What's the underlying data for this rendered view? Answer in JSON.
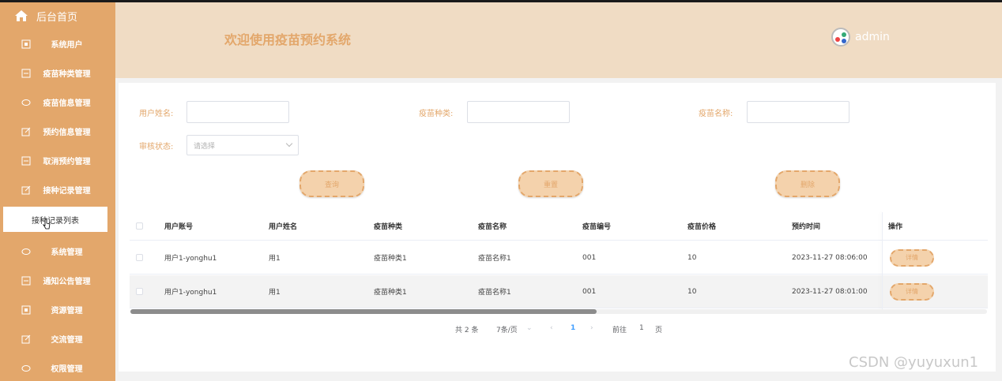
{
  "sidebar": {
    "home_label": "后台首页",
    "items": [
      {
        "label": "系统用户",
        "icon": "square-icon"
      },
      {
        "label": "疫苗种类管理",
        "icon": "square-icon"
      },
      {
        "label": "疫苗信息管理",
        "icon": "cloud-icon"
      },
      {
        "label": "预约信息管理",
        "icon": "edit-icon"
      },
      {
        "label": "取消预约管理",
        "icon": "square-icon"
      },
      {
        "label": "接种记录管理",
        "icon": "edit-icon"
      }
    ],
    "active_sub": "接种记录列表",
    "items_after": [
      {
        "label": "系统管理",
        "icon": "cloud-icon"
      },
      {
        "label": "通知公告管理",
        "icon": "square-icon"
      },
      {
        "label": "资源管理",
        "icon": "square-icon"
      },
      {
        "label": "交流管理",
        "icon": "edit-icon"
      },
      {
        "label": "权限管理",
        "icon": "cloud-icon"
      }
    ]
  },
  "header": {
    "title": "欢迎使用疫苗预约系统",
    "username": "admin"
  },
  "search": {
    "user_name_label": "用户姓名:",
    "vaccine_type_label": "疫苗种类:",
    "vaccine_name_label": "疫苗名称:",
    "review_status_label": "审核状态:",
    "review_status_placeholder": "请选择",
    "query_button": "查询",
    "reset_button": "重置",
    "delete_button": "删除"
  },
  "table": {
    "headers": [
      "用户账号",
      "用户姓名",
      "疫苗种类",
      "疫苗名称",
      "疫苗编号",
      "疫苗价格",
      "预约时间",
      "操作"
    ],
    "rows": [
      [
        "用户1-yonghu1",
        "用1",
        "疫苗种类1",
        "疫苗名称1",
        "001",
        "10",
        "2023-11-27 08:06:00",
        "详情"
      ],
      [
        "用户1-yonghu1",
        "用1",
        "疫苗种类1",
        "疫苗名称1",
        "001",
        "10",
        "2023-11-27 08:01:00",
        "详情"
      ]
    ]
  },
  "pagination": {
    "total": "共 2 条",
    "page_size": "7条/页",
    "current_page": "1",
    "goto_label": "前往",
    "goto_value": "1",
    "page_suffix": "页"
  },
  "watermark": "CSDN @yuyuxun1",
  "colors": {
    "sidebar_bg": "#e3a76b",
    "header_bg": "#f0dcc4",
    "accent": "#e3a76b",
    "pager_active": "#409eff"
  }
}
